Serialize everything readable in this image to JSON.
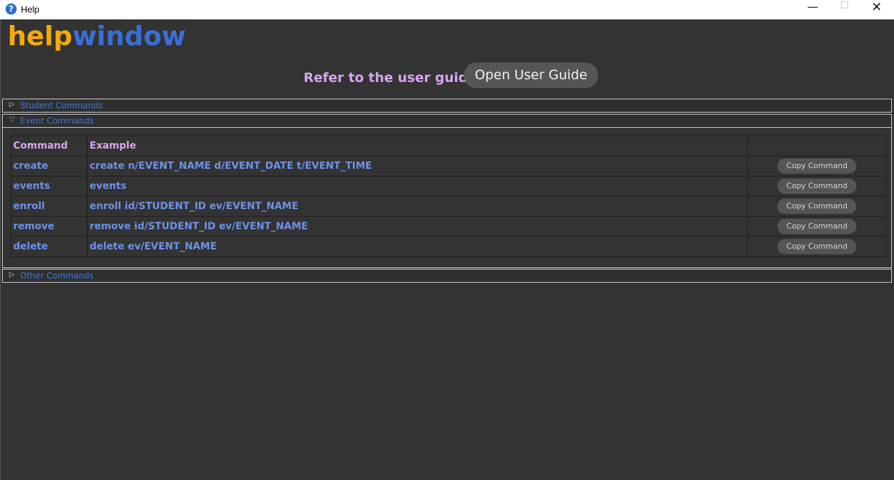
{
  "window": {
    "title": "Help",
    "app_icon": "?",
    "minimize_glyph": "—",
    "maximize_glyph": "☐",
    "close_glyph": "✕"
  },
  "heading": {
    "part1": "help",
    "part2": "window",
    "part1_color": "#f5a90c",
    "part2_color": "#3b6fd8"
  },
  "guide": {
    "label": "Refer to the user guide:",
    "button_label": "Open User Guide"
  },
  "panes": {
    "student": {
      "label": "Student Commands",
      "arrow": "▷",
      "expanded": false
    },
    "event": {
      "label": "Event Commands",
      "arrow": "▽",
      "expanded": true
    },
    "other": {
      "label": "Other Commands",
      "arrow": "▷",
      "expanded": false
    }
  },
  "table": {
    "headers": [
      "Command",
      "Example",
      ""
    ],
    "copy_label": "Copy Command",
    "rows": [
      {
        "command": "create",
        "example": "create n/EVENT_NAME d/EVENT_DATE t/EVENT_TIME"
      },
      {
        "command": "events",
        "example": "events"
      },
      {
        "command": "enroll",
        "example": "enroll id/STUDENT_ID ev/EVENT_NAME"
      },
      {
        "command": "remove",
        "example": "remove id/STUDENT_ID ev/EVENT_NAME"
      },
      {
        "command": "delete",
        "example": "delete ev/EVENT_NAME"
      }
    ]
  }
}
